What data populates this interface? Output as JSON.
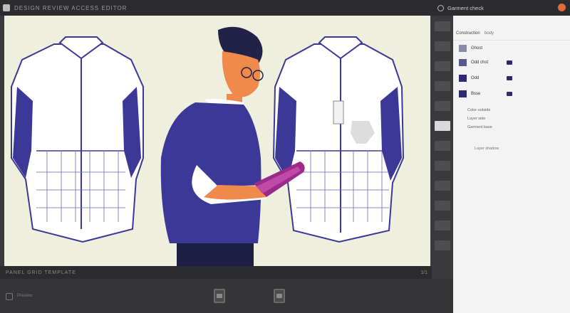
{
  "app": {
    "title": "DESIGN REVIEW  ACCESS  EDITOR",
    "canvas_label": "PANEL  GRID  TEMPLATE",
    "page_indicator": "1/1"
  },
  "panel": {
    "title": "Garment check",
    "field_label": "Construction",
    "field_value": "body",
    "rows": [
      {
        "label": "Ghost",
        "color": "#8a8aa8"
      },
      {
        "label": "Odd chst",
        "color": "#5a5a8a"
      },
      {
        "label": "Odd",
        "color": "#2e2a6e"
      },
      {
        "label": "Bsse",
        "color": "#2e2a6e"
      }
    ],
    "subrows": [
      "Color outside",
      "Layer side",
      "Garment base"
    ],
    "footer": "Layer shadow"
  },
  "thumbs": {
    "side_label": "Preview"
  },
  "colors": {
    "navy": "#2e2a6e",
    "accent": "#e36a3c",
    "canvas": "#eef0dd"
  }
}
